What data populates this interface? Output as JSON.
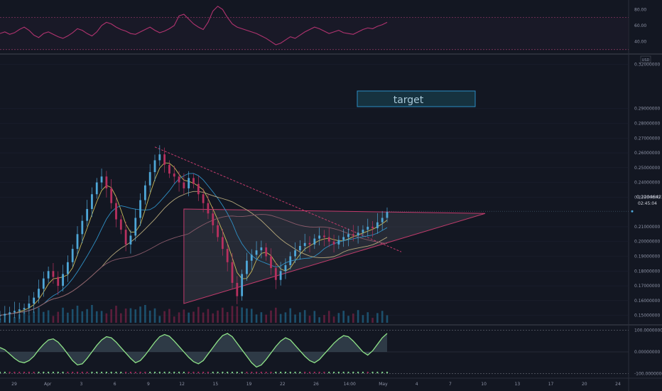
{
  "chart_data": [
    {
      "type": "line",
      "panel": "rsi",
      "yticks": [
        80,
        60,
        40
      ],
      "ytick_labels": [
        "80.00",
        "60.00",
        "40.00"
      ],
      "ylim": [
        28,
        90
      ],
      "levels": [
        70,
        30
      ],
      "series": [
        {
          "color": "#b0336f",
          "x": [
            0,
            2,
            4,
            6,
            8,
            10,
            12,
            14,
            16,
            18,
            20,
            22,
            24,
            26,
            28,
            30,
            32,
            34,
            36,
            38,
            40,
            42,
            44,
            46,
            48,
            50,
            52,
            54,
            56,
            58,
            60,
            62,
            64,
            66,
            68,
            70,
            72,
            74,
            76,
            78,
            80,
            82,
            84,
            86,
            88,
            90,
            92,
            94,
            96,
            98,
            100,
            102,
            104,
            106,
            108,
            110,
            112,
            114,
            116,
            118,
            120,
            122,
            124,
            126,
            128,
            130,
            132,
            134,
            136,
            138,
            140,
            142,
            144,
            146,
            148,
            150,
            152,
            154,
            156,
            158,
            160
          ],
          "values": [
            50,
            52,
            49,
            51,
            55,
            58,
            54,
            48,
            45,
            50,
            52,
            49,
            46,
            44,
            47,
            51,
            56,
            54,
            50,
            47,
            52,
            60,
            64,
            62,
            58,
            55,
            53,
            50,
            49,
            52,
            55,
            58,
            54,
            51,
            53,
            56,
            60,
            72,
            74,
            68,
            62,
            58,
            55,
            64,
            78,
            84,
            80,
            70,
            62,
            58,
            56,
            54,
            52,
            50,
            47,
            44,
            40,
            36,
            38,
            42,
            46,
            44,
            48,
            52,
            55,
            58,
            56,
            53,
            50,
            52,
            54,
            51,
            50,
            49,
            52,
            55,
            57,
            56,
            59,
            61,
            64
          ]
        }
      ]
    },
    {
      "type": "candlestick",
      "panel": "price",
      "annotation": "target",
      "last_price_label": "0.22046423",
      "countdown_label": "02:45:04",
      "currency_label": "USD",
      "ylim": [
        0.145,
        0.325
      ],
      "yticks": [
        0.32,
        0.29,
        0.28,
        0.27,
        0.26,
        0.25,
        0.24,
        0.23,
        0.21,
        0.2,
        0.19,
        0.18,
        0.17,
        0.16,
        0.15
      ],
      "ytick_labels": [
        "0.32000000",
        "0.29000000",
        "0.28000000",
        "0.27000000",
        "0.26000000",
        "0.25000000",
        "0.24000000",
        "0.23000000",
        "0.21000000",
        "0.20000000",
        "0.19000000",
        "0.18000000",
        "0.17000000",
        "0.16000000",
        "0.15000000"
      ],
      "x": [
        0,
        2,
        4,
        6,
        8,
        10,
        12,
        14,
        16,
        18,
        20,
        22,
        24,
        26,
        28,
        30,
        32,
        34,
        36,
        38,
        40,
        42,
        44,
        46,
        48,
        50,
        52,
        54,
        56,
        58,
        60,
        62,
        64,
        66,
        68,
        70,
        72,
        74,
        76,
        78,
        80,
        82,
        84,
        86,
        88,
        90,
        92,
        94,
        96,
        98,
        100,
        102,
        104,
        106,
        108,
        110,
        112,
        114,
        116,
        118,
        120,
        122,
        124,
        126,
        128,
        130,
        132,
        134,
        136,
        138,
        140,
        142,
        144,
        146,
        148,
        150,
        152,
        154,
        156,
        158,
        160
      ],
      "close": [
        0.15,
        0.151,
        0.152,
        0.153,
        0.154,
        0.155,
        0.158,
        0.162,
        0.168,
        0.175,
        0.18,
        0.176,
        0.17,
        0.178,
        0.186,
        0.195,
        0.205,
        0.214,
        0.222,
        0.232,
        0.24,
        0.244,
        0.236,
        0.226,
        0.215,
        0.208,
        0.198,
        0.204,
        0.216,
        0.228,
        0.238,
        0.247,
        0.255,
        0.259,
        0.252,
        0.246,
        0.244,
        0.24,
        0.236,
        0.243,
        0.239,
        0.232,
        0.226,
        0.219,
        0.211,
        0.203,
        0.195,
        0.186,
        0.172,
        0.163,
        0.178,
        0.187,
        0.191,
        0.194,
        0.196,
        0.19,
        0.182,
        0.174,
        0.18,
        0.184,
        0.19,
        0.194,
        0.197,
        0.199,
        0.198,
        0.202,
        0.204,
        0.203,
        0.2,
        0.198,
        0.201,
        0.203,
        0.205,
        0.204,
        0.206,
        0.208,
        0.21,
        0.209,
        0.213,
        0.216,
        0.22
      ]
    },
    {
      "type": "area",
      "panel": "oscillator",
      "yticks": [
        100,
        0,
        -100
      ],
      "ytick_labels": [
        "100.00000000",
        "0.00000000",
        "-100.00000000"
      ],
      "ylim": [
        -108,
        108
      ],
      "series": [
        {
          "color": "#8fe388",
          "x": [
            0,
            2,
            4,
            6,
            8,
            10,
            12,
            14,
            16,
            18,
            20,
            22,
            24,
            26,
            28,
            30,
            32,
            34,
            36,
            38,
            40,
            42,
            44,
            46,
            48,
            50,
            52,
            54,
            56,
            58,
            60,
            62,
            64,
            66,
            68,
            70,
            72,
            74,
            76,
            78,
            80,
            82,
            84,
            86,
            88,
            90,
            92,
            94,
            96,
            98,
            100,
            102,
            104,
            106,
            108,
            110,
            112,
            114,
            116,
            118,
            120,
            122,
            124,
            126,
            128,
            130,
            132,
            134,
            136,
            138,
            140,
            142,
            144,
            146,
            148,
            150,
            152,
            154,
            156,
            158,
            160
          ],
          "values": [
            20,
            10,
            -10,
            -30,
            -45,
            -50,
            -40,
            -20,
            10,
            35,
            55,
            60,
            45,
            20,
            -10,
            -40,
            -60,
            -55,
            -30,
            0,
            30,
            55,
            70,
            65,
            45,
            20,
            -5,
            -30,
            -50,
            -40,
            -15,
            15,
            45,
            70,
            80,
            72,
            50,
            25,
            0,
            -25,
            -45,
            -55,
            -40,
            -10,
            20,
            50,
            75,
            85,
            70,
            40,
            10,
            -20,
            -50,
            -70,
            -60,
            -35,
            -5,
            25,
            50,
            65,
            55,
            30,
            5,
            -20,
            -40,
            -50,
            -35,
            -10,
            15,
            40,
            60,
            75,
            70,
            50,
            25,
            0,
            -15,
            5,
            35,
            65,
            85
          ]
        }
      ]
    }
  ],
  "date_axis": {
    "labels": [
      "29",
      "Apr",
      "3",
      "6",
      "9",
      "12",
      "15",
      "19",
      "22",
      "26",
      "14:00",
      "May",
      "4",
      "7",
      "10",
      "13",
      "17",
      "20",
      "24"
    ]
  }
}
